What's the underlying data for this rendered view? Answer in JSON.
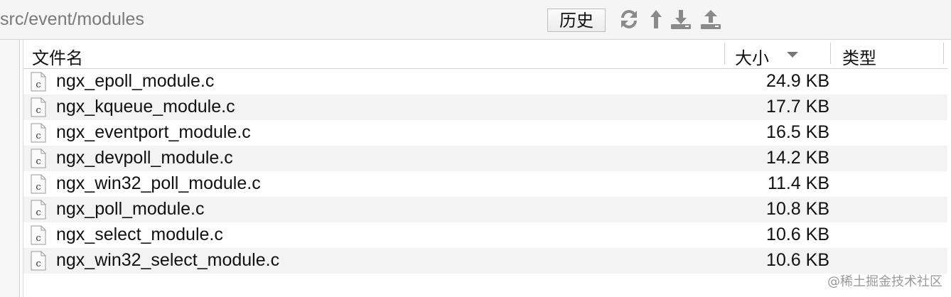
{
  "toolbar": {
    "path": "src/event/modules",
    "history_label": "历史",
    "icons": [
      "refresh-icon",
      "up-arrow-icon",
      "download-icon",
      "upload-icon"
    ]
  },
  "columns": {
    "name": "文件名",
    "size": "大小",
    "type": "类型"
  },
  "files": [
    {
      "name": "ngx_epoll_module.c",
      "size": "24.9 KB"
    },
    {
      "name": "ngx_kqueue_module.c",
      "size": "17.7 KB"
    },
    {
      "name": "ngx_eventport_module.c",
      "size": "16.5 KB"
    },
    {
      "name": "ngx_devpoll_module.c",
      "size": "14.2 KB"
    },
    {
      "name": "ngx_win32_poll_module.c",
      "size": "11.4 KB"
    },
    {
      "name": "ngx_poll_module.c",
      "size": "10.8 KB"
    },
    {
      "name": "ngx_select_module.c",
      "size": "10.6 KB"
    },
    {
      "name": "ngx_win32_select_module.c",
      "size": "10.6 KB"
    }
  ],
  "watermark": "@稀土掘金技术社区",
  "colors": {
    "icon_gray": "#8a8a8a",
    "row_alt": "#f3f3f3"
  }
}
